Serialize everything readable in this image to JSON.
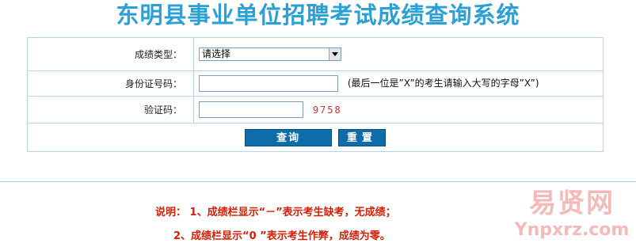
{
  "page": {
    "title": "东明县事业单位招聘考试成绩查询系统"
  },
  "form": {
    "score_type_label": "成绩类型：",
    "score_type_selected": "请选择",
    "id_label": "身份证号码：",
    "id_value": "",
    "id_hint": "(最后一位是”X”的考生请输入大写的字母”X”)",
    "captcha_label": "验证码：",
    "captcha_value": "",
    "captcha_code": "9758",
    "query_label": "查询",
    "reset_label": "重置"
  },
  "notes": {
    "line1": "说明：  1、成绩栏显示“－”表示考生缺考，无成绩；",
    "line2": "2、成绩栏显示“0 ”表示考生作弊，成绩为零。"
  },
  "watermark": {
    "top": "易贤网",
    "bottom": "Ynpxrz.com"
  },
  "colors": {
    "title": "#2aa0d4",
    "button": "#0f6cab",
    "note": "#d81e06",
    "border": "#b5d3e6"
  }
}
